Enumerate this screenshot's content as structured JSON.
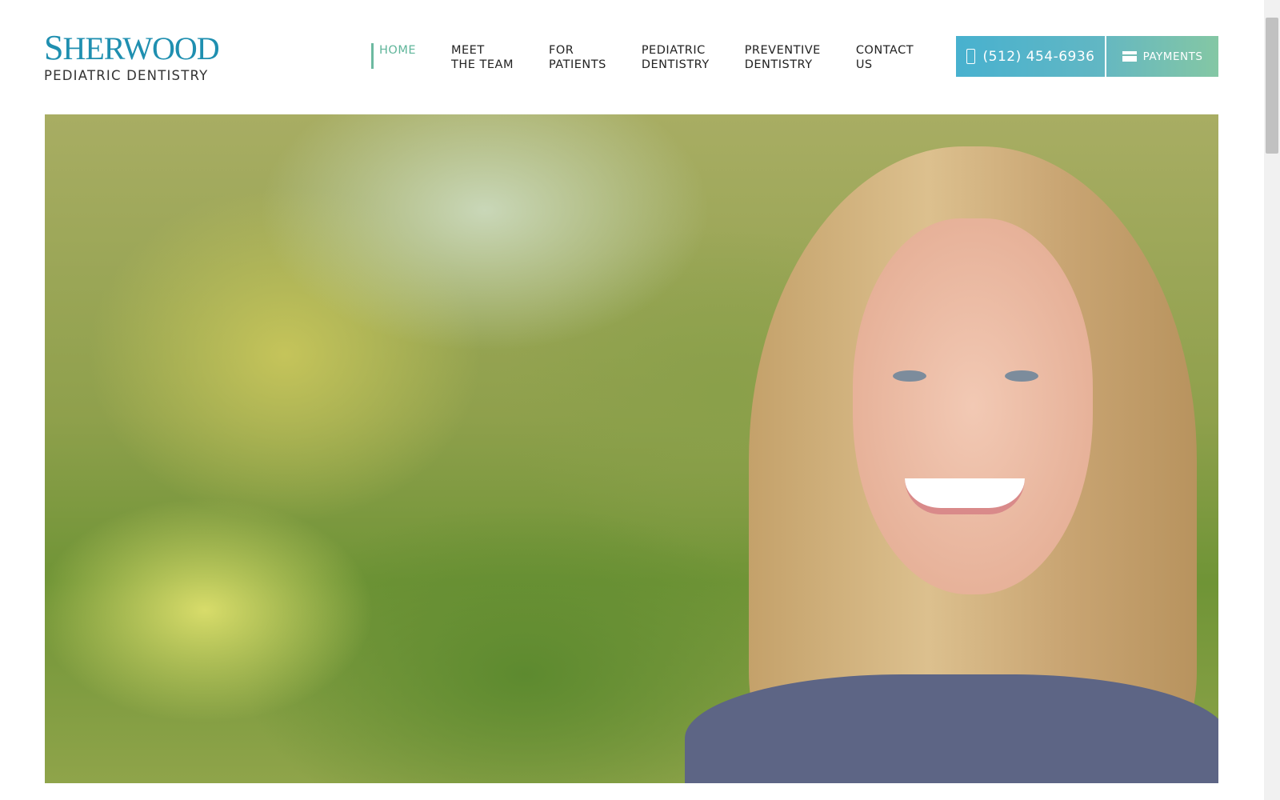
{
  "logo": {
    "name": "Sherwood",
    "tagline": "PEDIATRIC DENTISTRY"
  },
  "nav": [
    {
      "label": "HOME",
      "active": true
    },
    {
      "label": "MEET\nTHE TEAM"
    },
    {
      "label": "FOR\nPATIENTS"
    },
    {
      "label": "PEDIATRIC\nDENTISTRY"
    },
    {
      "label": "PREVENTIVE\nDENTISTRY"
    },
    {
      "label": "CONTACT\nUS"
    }
  ],
  "phone": {
    "label": "(512) 454-6936",
    "icon": "mobile-phone-icon"
  },
  "payments": {
    "label": "PAYMENTS",
    "icon": "credit-card-icon"
  },
  "colors": {
    "brand": "#1f8fb0",
    "active_nav": "#5fb59a",
    "phone_btn": "#48b1cf",
    "pay_btn": "#84c7a4"
  }
}
